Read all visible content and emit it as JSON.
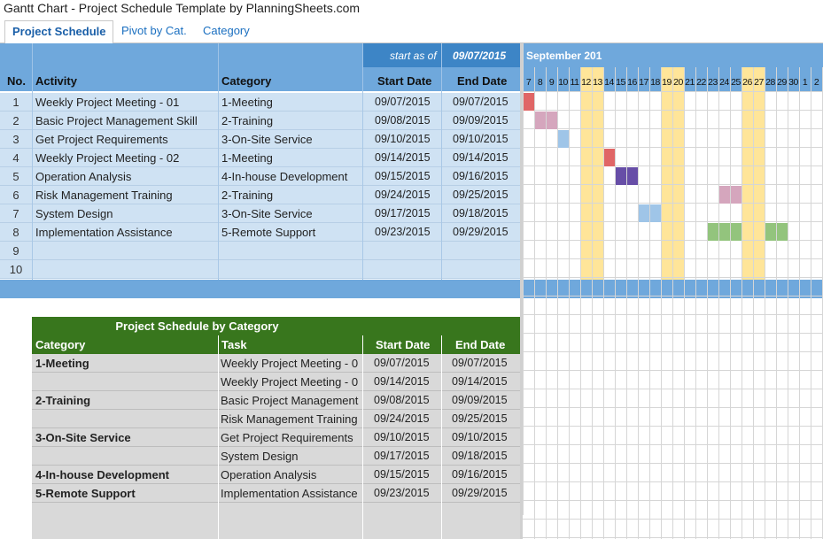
{
  "window_title": "Gantt Chart - Project Schedule Template by PlanningSheets.com",
  "tabs": [
    "Project Schedule",
    "Pivot by Cat.",
    "Category"
  ],
  "schedule": {
    "start_as_of_label": "start as of",
    "start_as_of_value": "09/07/2015",
    "month_label": "September 201",
    "columns": {
      "no": "No.",
      "activity": "Activity",
      "category": "Category",
      "start": "Start Date",
      "end": "End Date"
    },
    "rows": [
      {
        "no": "1",
        "activity": "Weekly Project Meeting - 01",
        "category": "1-Meeting",
        "start": "09/07/2015",
        "end": "09/07/2015"
      },
      {
        "no": "2",
        "activity": "Basic Project Management Skill",
        "category": "2-Training",
        "start": "09/08/2015",
        "end": "09/09/2015"
      },
      {
        "no": "3",
        "activity": "Get Project Requirements",
        "category": "3-On-Site Service",
        "start": "09/10/2015",
        "end": "09/10/2015"
      },
      {
        "no": "4",
        "activity": "Weekly Project Meeting - 02",
        "category": "1-Meeting",
        "start": "09/14/2015",
        "end": "09/14/2015"
      },
      {
        "no": "5",
        "activity": "Operation Analysis",
        "category": "4-In-house Development",
        "start": "09/15/2015",
        "end": "09/16/2015"
      },
      {
        "no": "6",
        "activity": "Risk Management Training",
        "category": "2-Training",
        "start": "09/24/2015",
        "end": "09/25/2015"
      },
      {
        "no": "7",
        "activity": "System Design",
        "category": "3-On-Site Service",
        "start": "09/17/2015",
        "end": "09/18/2015"
      },
      {
        "no": "8",
        "activity": "Implementation Assistance",
        "category": "5-Remote Support",
        "start": "09/23/2015",
        "end": "09/29/2015"
      },
      {
        "no": "9",
        "activity": "",
        "category": "",
        "start": "",
        "end": ""
      },
      {
        "no": "10",
        "activity": "",
        "category": "",
        "start": "",
        "end": ""
      }
    ],
    "days": [
      "7",
      "8",
      "9",
      "10",
      "11",
      "12",
      "13",
      "14",
      "15",
      "16",
      "17",
      "18",
      "19",
      "20",
      "21",
      "22",
      "23",
      "24",
      "25",
      "26",
      "27",
      "28",
      "29",
      "30",
      "1",
      "2"
    ]
  },
  "by_category": {
    "title": "Project Schedule by Category",
    "columns": {
      "category": "Category",
      "task": "Task",
      "start": "Start Date",
      "end": "End Date"
    },
    "rows": [
      {
        "category": "1-Meeting",
        "task": "Weekly Project Meeting - 0",
        "start": "09/07/2015",
        "end": "09/07/2015"
      },
      {
        "category": "",
        "task": "Weekly Project Meeting - 0",
        "start": "09/14/2015",
        "end": "09/14/2015"
      },
      {
        "category": "2-Training",
        "task": "Basic Project Management",
        "start": "09/08/2015",
        "end": "09/09/2015"
      },
      {
        "category": "",
        "task": "Risk Management Training",
        "start": "09/24/2015",
        "end": "09/25/2015"
      },
      {
        "category": "3-On-Site Service",
        "task": "Get Project Requirements",
        "start": "09/10/2015",
        "end": "09/10/2015"
      },
      {
        "category": "",
        "task": "System Design",
        "start": "09/17/2015",
        "end": "09/18/2015"
      },
      {
        "category": "4-In-house Development",
        "task": "Operation Analysis",
        "start": "09/15/2015",
        "end": "09/16/2015"
      },
      {
        "category": "5-Remote Support",
        "task": "Implementation Assistance",
        "start": "09/23/2015",
        "end": "09/29/2015"
      }
    ]
  },
  "colors": {
    "header_blue": "#6fa8dc",
    "dark_blue": "#3d85c6",
    "row_blue": "#cfe2f3",
    "weekend": "#ffe599",
    "green_header": "#38761d",
    "grey_row": "#d9d9d9",
    "category_colors": {
      "1-Meeting": "#e06666",
      "2-Training": "#d5a6bd",
      "3-On-Site Service": "#9fc5e8",
      "4-In-house Development": "#674ea7",
      "5-Remote Support": "#93c47d"
    }
  }
}
